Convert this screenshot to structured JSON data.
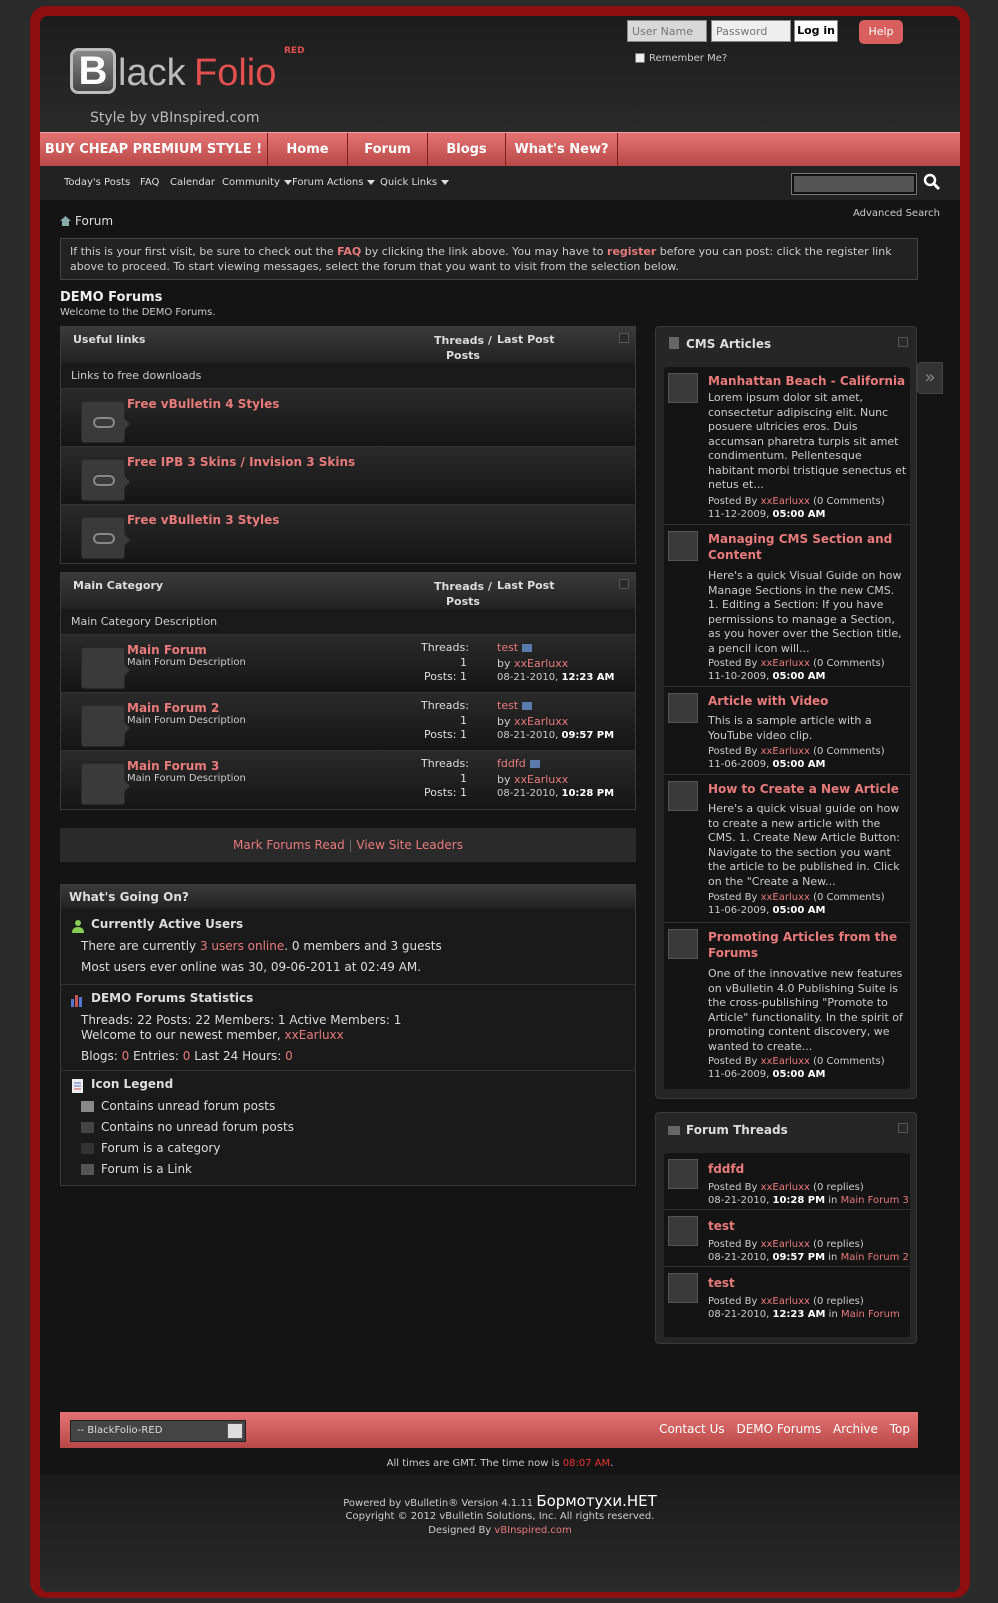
{
  "header": {
    "logo_b": "B",
    "logo_black": "lack",
    "logo_folio": "Folio",
    "logo_red": "RED",
    "logo_sub": "Style by vBInspired.com",
    "username_placeholder": "User Name",
    "password_placeholder": "Password",
    "login_label": "Log in",
    "help_label": "Help",
    "remember_label": "Remember Me?"
  },
  "navbar": {
    "tabs": [
      "BUY CHEAP PREMIUM STYLE !",
      "Home",
      "Forum",
      "Blogs",
      "What's New?"
    ]
  },
  "subnav": {
    "items": [
      "Today's Posts",
      "FAQ",
      "Calendar",
      "Community",
      "Forum Actions",
      "Quick Links"
    ],
    "advanced_search": "Advanced Search"
  },
  "breadcrumb": "Forum",
  "notice": {
    "p1": "If this is your first visit, be sure to check out the ",
    "faq": "FAQ",
    "p2": " by clicking the link above. You may have to ",
    "register": "register",
    "p3": " before you can post: click the register link above to proceed. To start viewing messages, select the forum that you want to visit from the selection below."
  },
  "forum": {
    "title": "DEMO Forums",
    "desc": "Welcome to the DEMO Forums."
  },
  "useful_links": {
    "title": "Useful links",
    "threads_posts": "Threads / Posts",
    "last_post": "Last Post",
    "desc": "Links to free downloads",
    "links": [
      "Free vBulletin 4 Styles",
      "Free IPB 3 Skins / Invision 3 Skins",
      "Free vBulletin 3 Styles"
    ]
  },
  "main_category": {
    "title": "Main Category",
    "threads_posts": "Threads / Posts",
    "last_post": "Last Post",
    "desc": "Main Category Description",
    "forums": [
      {
        "name": "Main Forum",
        "desc": "Main Forum Description",
        "threads_label": "Threads:",
        "threads": "1",
        "posts_label": "Posts:",
        "posts": "1",
        "lp_title": "test",
        "by": "by",
        "lp_user": "xxEarluxx",
        "lp_date": "08-21-2010,",
        "lp_time": "12:23 AM"
      },
      {
        "name": "Main Forum 2",
        "desc": "Main Forum Description",
        "threads_label": "Threads:",
        "threads": "1",
        "posts_label": "Posts:",
        "posts": "1",
        "lp_title": "test",
        "by": "by",
        "lp_user": "xxEarluxx",
        "lp_date": "08-21-2010,",
        "lp_time": "09:57 PM"
      },
      {
        "name": "Main Forum 3",
        "desc": "Main Forum Description",
        "threads_label": "Threads:",
        "threads": "1",
        "posts_label": "Posts:",
        "posts": "1",
        "lp_title": "fddfd",
        "by": "by",
        "lp_user": "xxEarluxx",
        "lp_date": "08-21-2010,",
        "lp_time": "10:28 PM"
      }
    ]
  },
  "markbar": {
    "mark_read": "Mark Forums Read",
    "sep": "|",
    "leaders": "View Site Leaders"
  },
  "wgo": {
    "title": "What's Going On?",
    "active_title": "Currently Active Users",
    "active_p1": "There are currently ",
    "active_link": "3 users online",
    "active_p2": ". 0 members and 3 guests",
    "most_users": "Most users ever online was 30, 09-06-2011 at 02:49 AM.",
    "stats_title": "DEMO Forums Statistics",
    "stats_line": "Threads: 22  Posts: 22  Members: 1  Active Members: 1",
    "newest_p1": "Welcome to our newest member, ",
    "newest_user": "xxEarluxx",
    "blogs_label": "Blogs: ",
    "blogs": "0",
    "entries_label": "  Entries: ",
    "entries": "0",
    "last24_label": "  Last 24 Hours: ",
    "last24": "0",
    "legend_title": "Icon Legend",
    "legend": [
      "Contains unread forum posts",
      "Contains no unread forum posts",
      "Forum is a category",
      "Forum is a Link"
    ]
  },
  "cms": {
    "title": "CMS Articles",
    "articles": [
      {
        "title": "Manhattan Beach - California",
        "body": "Lorem ipsum dolor sit amet, consectetur adipiscing elit. Nunc posuere ultricies eros. Duis accumsan pharetra turpis sit amet condimentum. Pellentesque habitant morbi tristique senectus et netus et...",
        "posted_by": "Posted By ",
        "user": "xxEarluxx",
        "comments": " (0 Comments)",
        "date": "11-12-2009, ",
        "time": "05:00 AM"
      },
      {
        "title": "Managing CMS Section and Content",
        "body": "Here's a quick Visual Guide on how Manage Sections in the new CMS. 1. Editing a Section: If you have permissions to manage a Section, as you hover over the Section title, a pencil icon will...",
        "posted_by": "Posted By ",
        "user": "xxEarluxx",
        "comments": " (0 Comments)",
        "date": "11-10-2009, ",
        "time": "05:00 AM"
      },
      {
        "title": "Article with Video",
        "body": "This is a sample article with a YouTube video clip.",
        "posted_by": "Posted By ",
        "user": "xxEarluxx",
        "comments": " (0 Comments)",
        "date": "11-06-2009, ",
        "time": "05:00 AM"
      },
      {
        "title": "How to Create a New Article",
        "body": "Here's a quick visual guide on how to create a new article with the CMS. 1. Create New Article Button: Navigate to the section you want the article to be published in. Click on the \"Create a New...",
        "posted_by": "Posted By ",
        "user": "xxEarluxx",
        "comments": " (0 Comments)",
        "date": "11-06-2009, ",
        "time": "05:00 AM"
      },
      {
        "title": "Promoting Articles from the Forums",
        "body": "One of the innovative new features on vBulletin 4.0 Publishing Suite is the cross-publishing \"Promote to Article\" functionality. In the spirit of promoting content discovery, we wanted to create...",
        "posted_by": "Posted By ",
        "user": "xxEarluxx",
        "comments": " (0 Comments)",
        "date": "11-06-2009, ",
        "time": "05:00 AM"
      }
    ]
  },
  "threads": {
    "title": "Forum Threads",
    "items": [
      {
        "title": "fddfd",
        "posted_by": "Posted By ",
        "user": "xxEarluxx",
        "replies": " (0 replies)",
        "date": "08-21-2010, ",
        "time": "10:28 PM",
        "in": " in ",
        "forum": "Main Forum 3"
      },
      {
        "title": "test",
        "posted_by": "Posted By ",
        "user": "xxEarluxx",
        "replies": " (0 replies)",
        "date": "08-21-2010, ",
        "time": "09:57 PM",
        "in": " in ",
        "forum": "Main Forum 2"
      },
      {
        "title": "test",
        "posted_by": "Posted By ",
        "user": "xxEarluxx",
        "replies": " (0 replies)",
        "date": "08-21-2010, ",
        "time": "12:23 AM",
        "in": " in ",
        "forum": "Main Forum"
      }
    ]
  },
  "footer": {
    "style_select": "-- BlackFolio-RED",
    "links": [
      "Contact Us",
      "DEMO Forums",
      "Archive",
      "Top"
    ],
    "time_p1": "All times are GMT. The time now is ",
    "time_now": "08:07 AM",
    "time_p2": ".",
    "powered": "Powered by vBulletin® Version 4.1.11 ",
    "powered_extra": "Бормотухи.НЕТ",
    "copyright": "Copyright © 2012 vBulletin Solutions, Inc. All rights reserved.",
    "designed_p1": "Designed By ",
    "designed_link": "vBInspired.com"
  },
  "colors": {
    "frame": "#8e0f10",
    "accent": "#e87a7a",
    "navbar": "#d15c5c"
  }
}
